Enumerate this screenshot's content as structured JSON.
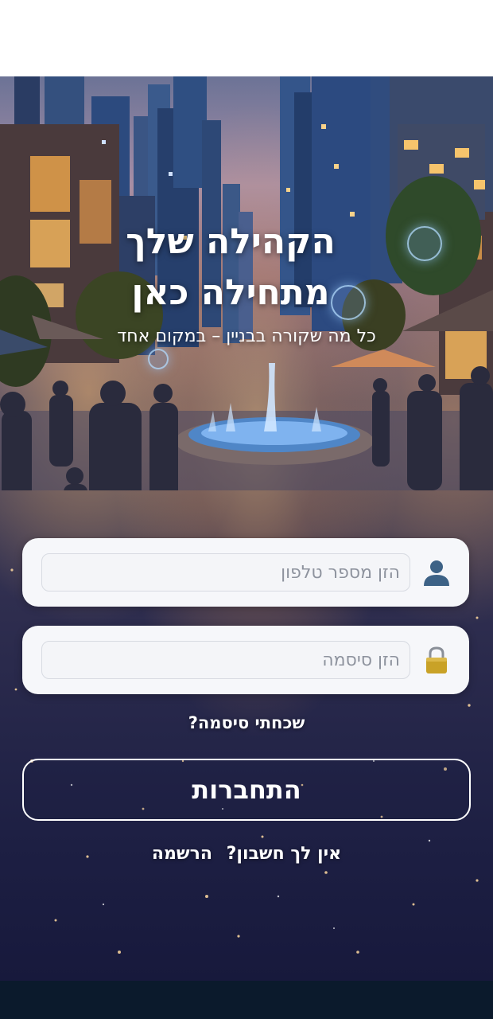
{
  "hero": {
    "title_line1": "הקהילה שלך",
    "title_line2": "מתחילה כאן",
    "subtitle": "כל מה שקורה בבניין – במקום אחד"
  },
  "form": {
    "phone": {
      "placeholder": "הזן מספר טלפון",
      "value": "",
      "icon": "user-icon"
    },
    "password": {
      "placeholder": "הזן סיסמה",
      "value": "",
      "icon": "lock-icon"
    },
    "forgot_password": "שכחתי סיסמה?",
    "login_button": "התחברות",
    "no_account_text": "אין לך חשבון?",
    "signup_link": "הרשמה"
  },
  "colors": {
    "background": "#ffffff",
    "bottom_bar": "#0b1a2c",
    "text_light": "#ffffff",
    "card": "#f6f7fa",
    "icon_blue": "#3d6286",
    "lock_gold": "#c9a227"
  }
}
